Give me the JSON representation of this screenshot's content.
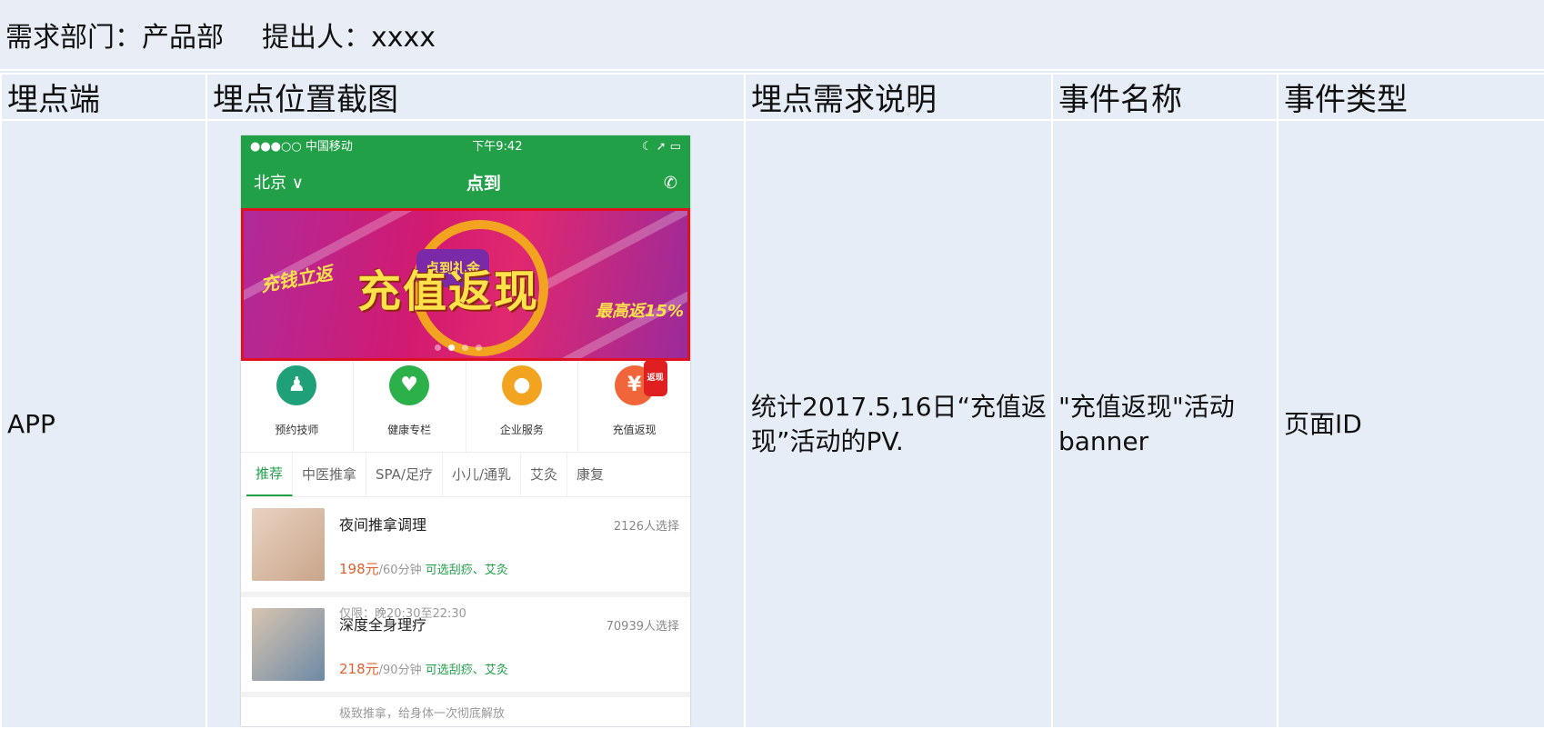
{
  "header": {
    "department": "需求部门：产品部",
    "proposer": "提出人：xxxx"
  },
  "table": {
    "columns": [
      "埋点端",
      "埋点位置截图",
      "埋点需求说明",
      "事件名称",
      "事件类型"
    ],
    "row": {
      "platform": "APP",
      "description": "统计2017.5,16日“充值返现”活动的PV.",
      "event_name": "\"充值返现\"活动banner",
      "event_type": "页面ID"
    }
  },
  "phone": {
    "status": {
      "carrier": "●●●○○ 中国移动",
      "time": "下午9:42",
      "right": "☾ ➚ ▭"
    },
    "nav": {
      "city": "北京",
      "title": "点到"
    },
    "banner": {
      "tag": "点到礼金",
      "headline": "充值返现",
      "left_text": "充钱立返",
      "right_text": "最高返15%"
    },
    "icons": [
      {
        "label": "预约技师",
        "color": "#1fa078",
        "icon": "technician-icon"
      },
      {
        "label": "健康专栏",
        "color": "#2cb04a",
        "icon": "heart-icon"
      },
      {
        "label": "企业服务",
        "color": "#f2a320",
        "icon": "person-icon"
      },
      {
        "label": "充值返现",
        "color": "#f0663a",
        "icon": "yen-icon",
        "badge": "返现"
      }
    ],
    "tabs": [
      "推荐",
      "中医推拿",
      "SPA/足疗",
      "小儿/通乳",
      "艾灸",
      "康复"
    ],
    "items": [
      {
        "name": "夜间推拿调理",
        "count": "2126人选择",
        "price": "198元",
        "duration": "/60分钟",
        "options": "可选刮痧、艾灸",
        "note": "仅限：晚20:30至22:30"
      },
      {
        "name": "深度全身理疗",
        "count": "70939人选择",
        "price": "218元",
        "duration": "/90分钟",
        "options": "可选刮痧、艾灸",
        "note": "极致推拿，给身体一次彻底解放"
      }
    ]
  }
}
